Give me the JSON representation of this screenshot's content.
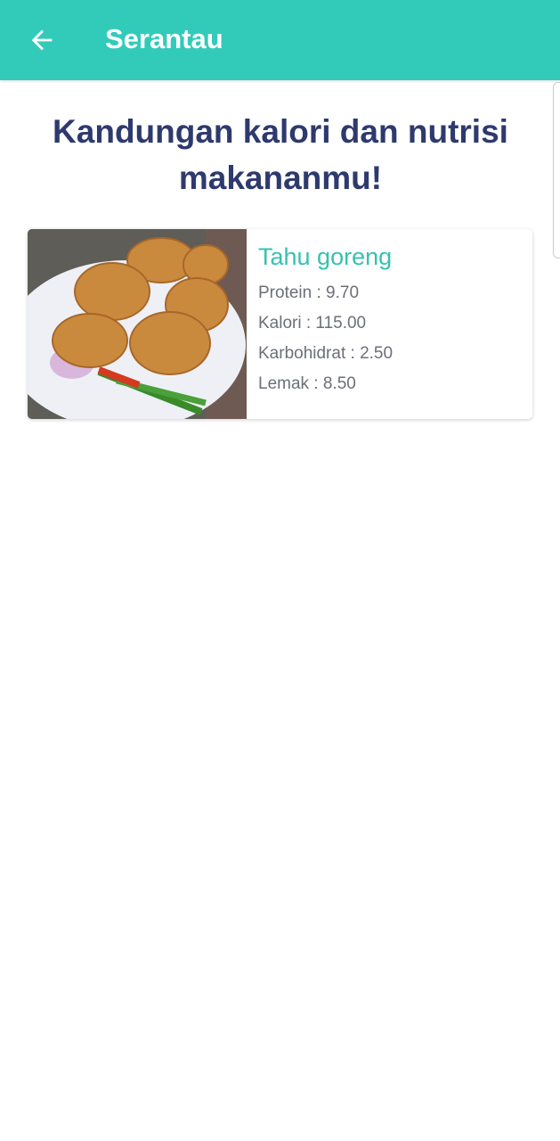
{
  "appbar": {
    "title": "Serantau",
    "back_icon": "arrow-left-icon"
  },
  "main": {
    "heading": "Kandungan kalori dan nutrisi makananmu!",
    "foods": [
      {
        "name": "Tahu goreng",
        "protein": "Protein : 9.70",
        "kalori": "Kalori : 115.00",
        "karbohidrat": "Karbohidrat : 2.50",
        "lemak": "Lemak : 8.50"
      }
    ]
  },
  "colors": {
    "accent": "#32cbba",
    "heading": "#2e3a6e",
    "food_name": "#36c1b0",
    "text": "#6b6f78"
  }
}
